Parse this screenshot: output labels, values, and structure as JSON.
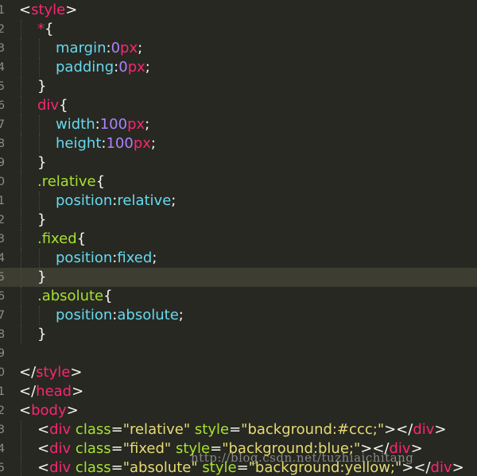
{
  "editor": {
    "colors": {
      "background": "#272822",
      "current_line": "#3e3d32",
      "tag": "#f92672",
      "attribute": "#a6e22e",
      "string": "#e6db74",
      "property": "#66d9ef",
      "number": "#ae81ff",
      "plain": "#f8f8f2"
    },
    "lines": [
      {
        "indent": 0,
        "current": false,
        "tokens": [
          {
            "t": "<",
            "c": "p"
          },
          {
            "t": "style",
            "c": "tag"
          },
          {
            "t": ">",
            "c": "p"
          }
        ]
      },
      {
        "indent": 1,
        "current": false,
        "tokens": [
          {
            "t": "*",
            "c": "tag"
          },
          {
            "t": "{",
            "c": "p"
          }
        ]
      },
      {
        "indent": 2,
        "current": false,
        "tokens": [
          {
            "t": "margin",
            "c": "prop"
          },
          {
            "t": ":",
            "c": "p"
          },
          {
            "t": "0",
            "c": "num"
          },
          {
            "t": "px",
            "c": "unit"
          },
          {
            "t": ";",
            "c": "p"
          }
        ]
      },
      {
        "indent": 2,
        "current": false,
        "tokens": [
          {
            "t": "padding",
            "c": "prop"
          },
          {
            "t": ":",
            "c": "p"
          },
          {
            "t": "0",
            "c": "num"
          },
          {
            "t": "px",
            "c": "unit"
          },
          {
            "t": ";",
            "c": "p"
          }
        ]
      },
      {
        "indent": 1,
        "current": false,
        "tokens": [
          {
            "t": "}",
            "c": "p"
          }
        ]
      },
      {
        "indent": 1,
        "current": false,
        "tokens": [
          {
            "t": "div",
            "c": "tag"
          },
          {
            "t": "{",
            "c": "p"
          }
        ]
      },
      {
        "indent": 2,
        "current": false,
        "tokens": [
          {
            "t": "width",
            "c": "prop"
          },
          {
            "t": ":",
            "c": "p"
          },
          {
            "t": "100",
            "c": "num"
          },
          {
            "t": "px",
            "c": "unit"
          },
          {
            "t": ";",
            "c": "p"
          }
        ]
      },
      {
        "indent": 2,
        "current": false,
        "tokens": [
          {
            "t": "height",
            "c": "prop"
          },
          {
            "t": ":",
            "c": "p"
          },
          {
            "t": "100",
            "c": "num"
          },
          {
            "t": "px",
            "c": "unit"
          },
          {
            "t": ";",
            "c": "p"
          }
        ]
      },
      {
        "indent": 1,
        "current": false,
        "tokens": [
          {
            "t": "}",
            "c": "p"
          }
        ]
      },
      {
        "indent": 1,
        "current": false,
        "tokens": [
          {
            "t": ".relative",
            "c": "sel"
          },
          {
            "t": "{",
            "c": "p"
          }
        ]
      },
      {
        "indent": 2,
        "current": false,
        "tokens": [
          {
            "t": "position",
            "c": "prop"
          },
          {
            "t": ":",
            "c": "p"
          },
          {
            "t": "relative",
            "c": "prop"
          },
          {
            "t": ";",
            "c": "p"
          }
        ]
      },
      {
        "indent": 1,
        "current": false,
        "tokens": [
          {
            "t": "}",
            "c": "p"
          }
        ]
      },
      {
        "indent": 1,
        "current": false,
        "tokens": [
          {
            "t": ".fixed",
            "c": "sel"
          },
          {
            "t": "{",
            "c": "p"
          }
        ]
      },
      {
        "indent": 2,
        "current": false,
        "tokens": [
          {
            "t": "position",
            "c": "prop"
          },
          {
            "t": ":",
            "c": "p"
          },
          {
            "t": "fixed",
            "c": "prop"
          },
          {
            "t": ";",
            "c": "p"
          }
        ]
      },
      {
        "indent": 1,
        "current": true,
        "tokens": [
          {
            "t": "}",
            "c": "p"
          }
        ]
      },
      {
        "indent": 1,
        "current": false,
        "tokens": [
          {
            "t": ".absolute",
            "c": "sel"
          },
          {
            "t": "{",
            "c": "p"
          }
        ]
      },
      {
        "indent": 2,
        "current": false,
        "tokens": [
          {
            "t": "position",
            "c": "prop"
          },
          {
            "t": ":",
            "c": "p"
          },
          {
            "t": "absolute",
            "c": "prop"
          },
          {
            "t": ";",
            "c": "p"
          }
        ]
      },
      {
        "indent": 1,
        "current": false,
        "tokens": [
          {
            "t": "}",
            "c": "p"
          }
        ]
      },
      {
        "indent": 0,
        "current": false,
        "tokens": []
      },
      {
        "indent": 0,
        "current": false,
        "tokens": [
          {
            "t": "</",
            "c": "p"
          },
          {
            "t": "style",
            "c": "tag"
          },
          {
            "t": ">",
            "c": "p"
          }
        ]
      },
      {
        "indent": 0,
        "current": false,
        "tokens": [
          {
            "t": "</",
            "c": "p"
          },
          {
            "t": "head",
            "c": "tag"
          },
          {
            "t": ">",
            "c": "p"
          }
        ]
      },
      {
        "indent": 0,
        "current": false,
        "tokens": [
          {
            "t": "<",
            "c": "p"
          },
          {
            "t": "body",
            "c": "tag"
          },
          {
            "t": ">",
            "c": "p"
          }
        ]
      },
      {
        "indent": 1,
        "current": false,
        "tokens": [
          {
            "t": "<",
            "c": "p"
          },
          {
            "t": "div",
            "c": "tag"
          },
          {
            "t": " ",
            "c": "p"
          },
          {
            "t": "class",
            "c": "attr"
          },
          {
            "t": "=",
            "c": "p"
          },
          {
            "t": "\"relative\"",
            "c": "str"
          },
          {
            "t": " ",
            "c": "p"
          },
          {
            "t": "style",
            "c": "attr"
          },
          {
            "t": "=",
            "c": "p"
          },
          {
            "t": "\"background:#ccc;\"",
            "c": "str"
          },
          {
            "t": "></",
            "c": "p"
          },
          {
            "t": "div",
            "c": "tag"
          },
          {
            "t": ">",
            "c": "p"
          }
        ]
      },
      {
        "indent": 1,
        "current": false,
        "tokens": [
          {
            "t": "<",
            "c": "p"
          },
          {
            "t": "div",
            "c": "tag"
          },
          {
            "t": " ",
            "c": "p"
          },
          {
            "t": "class",
            "c": "attr"
          },
          {
            "t": "=",
            "c": "p"
          },
          {
            "t": "\"fixed\"",
            "c": "str"
          },
          {
            "t": " ",
            "c": "p"
          },
          {
            "t": "style",
            "c": "attr"
          },
          {
            "t": "=",
            "c": "p"
          },
          {
            "t": "\"background:blue;\"",
            "c": "str"
          },
          {
            "t": "></",
            "c": "p"
          },
          {
            "t": "div",
            "c": "tag"
          },
          {
            "t": ">",
            "c": "p"
          }
        ]
      },
      {
        "indent": 1,
        "current": false,
        "tokens": [
          {
            "t": "<",
            "c": "p"
          },
          {
            "t": "div",
            "c": "tag"
          },
          {
            "t": " ",
            "c": "p"
          },
          {
            "t": "class",
            "c": "attr"
          },
          {
            "t": "=",
            "c": "p"
          },
          {
            "t": "\"absolute\"",
            "c": "str"
          },
          {
            "t": " ",
            "c": "p"
          },
          {
            "t": "style",
            "c": "attr"
          },
          {
            "t": "=",
            "c": "p"
          },
          {
            "t": "\"background:yellow;\"",
            "c": "str"
          },
          {
            "t": "></",
            "c": "p"
          },
          {
            "t": "div",
            "c": "tag"
          },
          {
            "t": ">",
            "c": "p"
          }
        ]
      }
    ]
  },
  "watermark": "http://blog.csdn.net/tuzhiaichitang"
}
